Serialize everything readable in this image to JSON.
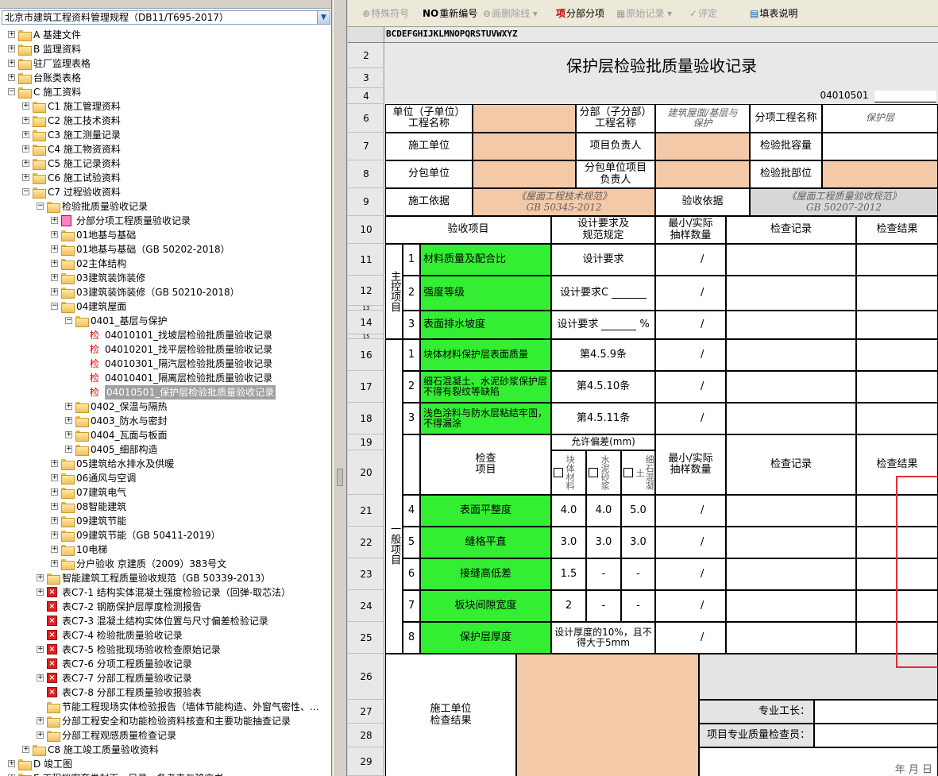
{
  "left_pane": {
    "spec_selector": "北京市建筑工程资料管理规程（DB11/T695-2017）",
    "tree": [
      {
        "label": "A 基建文件"
      },
      {
        "label": "B 监理资料"
      },
      {
        "label": "驻厂监理表格"
      },
      {
        "label": "台账类表格"
      },
      {
        "label": "C 施工资料"
      },
      {
        "label": "C1 施工管理资料"
      },
      {
        "label": "C2 施工技术资料"
      },
      {
        "label": "C3 施工测量记录"
      },
      {
        "label": "C4 施工物资资料"
      },
      {
        "label": "C5 施工记录资料"
      },
      {
        "label": "C6 施工试验资料"
      },
      {
        "label": "C7 过程验收资料"
      },
      {
        "label": "检验批质量验收记录"
      },
      {
        "label": "分部分项工程质量验收记录"
      },
      {
        "label": "01地基与基础"
      },
      {
        "label": "01地基与基础（GB 50202-2018）"
      },
      {
        "label": "02主体结构"
      },
      {
        "label": "03建筑装饰装修"
      },
      {
        "label": "03建筑装饰装修（GB 50210-2018）"
      },
      {
        "label": "04建筑屋面"
      },
      {
        "label": "0401_基层与保护"
      },
      {
        "label": "04010101_找坡层检验批质量验收记录"
      },
      {
        "label": "04010201_找平层检验批质量验收记录"
      },
      {
        "label": "04010301_隔汽层检验批质量验收记录"
      },
      {
        "label": "04010401_隔离层检验批质量验收记录"
      },
      {
        "label": "04010501_保护层检验批质量验收记录"
      },
      {
        "label": "0402_保温与隔热"
      },
      {
        "label": "0403_防水与密封"
      },
      {
        "label": "0404_瓦面与板面"
      },
      {
        "label": "0405_细部构造"
      },
      {
        "label": "05建筑给水排水及供暖"
      },
      {
        "label": "06通风与空调"
      },
      {
        "label": "07建筑电气"
      },
      {
        "label": "08智能建筑"
      },
      {
        "label": "09建筑节能"
      },
      {
        "label": "09建筑节能（GB 50411-2019）"
      },
      {
        "label": "10电梯"
      },
      {
        "label": "分户验收 京建质（2009）383号文"
      },
      {
        "label": "智能建筑工程质量验收规范（GB 50339-2013）"
      },
      {
        "label": "表C7-1 结构实体混凝土强度检验记录（回弹-取芯法）"
      },
      {
        "label": "表C7-2 钢筋保护层厚度检测报告"
      },
      {
        "label": "表C7-3 混凝土结构实体位置与尺寸偏差检验记录"
      },
      {
        "label": "表C7-4 检验批质量验收记录"
      },
      {
        "label": "表C7-5 检验批现场验收检查原始记录"
      },
      {
        "label": "表C7-6 分项工程质量验收记录"
      },
      {
        "label": "表C7-7 分部工程质量验收记录"
      },
      {
        "label": "表C7-8 分部工程质量验收报验表"
      },
      {
        "label": "节能工程现场实体检验报告（墙体节能构造、外窗气密性、..."
      },
      {
        "label": "分部工程安全和功能检验资料核查和主要功能抽查记录"
      },
      {
        "label": "分部工程观感质量检查记录"
      },
      {
        "label": "C8 施工竣工质量验收资料"
      },
      {
        "label": "D 竣工图"
      },
      {
        "label": "E 工程档案套卷封面、目录、备考表与移交书"
      }
    ],
    "check_glyph": "检"
  },
  "toolbar": {
    "special_symbol": "特殊符号",
    "renumber_icon": "NO",
    "renumber": "重新编号",
    "delete_line": "画删除线",
    "sub_item_icon": "项",
    "sub_item": "分部分项",
    "raw_record": "原始记录",
    "evaluate": "评定",
    "fill_guide": "填表说明"
  },
  "sheet": {
    "col_letters": "BCDEFGHIJKLMNOPQRSTUVWXYZ",
    "row_numbers": [
      "2",
      "3",
      "4",
      "6",
      "7",
      "8",
      "9",
      "10",
      "11",
      "12",
      "13",
      "14",
      "15",
      "16",
      "17",
      "18",
      "19",
      "20",
      "21",
      "22",
      "23",
      "24",
      "25",
      "26",
      "27",
      "28",
      "29"
    ],
    "title": "保护层检验批质量验收记录",
    "code": "04010501",
    "header": {
      "unit_label": "单位（子单位）\n工程名称",
      "sub_div_label": "分部（子分部）\n工程名称",
      "sub_div_value": "建筑屋面/基层与\n保护",
      "item_label": "分项工程名称",
      "item_value": "保护层",
      "contractor_label": "施工单位",
      "pm_label": "项目负责人",
      "batch_capacity_label": "检验批容量",
      "subcontractor_label": "分包单位",
      "sub_pm_label": "分包单位项目\n负责人",
      "batch_location_label": "检验批部位",
      "basis_label": "施工依据",
      "basis_value": "《屋面工程技术规范》\nGB 50345-2012",
      "acceptance_basis_label": "验收依据",
      "acceptance_basis_value": "《屋面工程质量验收规范》\nGB 50207-2012"
    },
    "columns": {
      "item": "验收项目",
      "design": "设计要求及\n规范规定",
      "sample": "最小/实际\n抽样数量",
      "record": "检查记录",
      "result": "检查结果"
    },
    "main_control_label": "主控项目",
    "main_items": [
      {
        "no": "1",
        "name": "材料质量及配合比",
        "req": "设计要求",
        "slash": "/"
      },
      {
        "no": "2",
        "name": "强度等级",
        "req": "设计要求C",
        "slash": "/"
      },
      {
        "no": "3",
        "name": "表面排水坡度",
        "req": "设计要求",
        "unit": "%",
        "slash": "/"
      }
    ],
    "general_label": "一般项目",
    "general_items": [
      {
        "no": "1",
        "name": "块体材料保护层表面质量",
        "req": "第4.5.9条",
        "slash": "/"
      },
      {
        "no": "2",
        "name": "细石混凝土、水泥砂浆保护层不得有裂纹等缺陷",
        "req": "第4.5.10条",
        "slash": "/"
      },
      {
        "no": "3",
        "name": "浅色涂料与防水层粘结牢固，不得漏涂",
        "req": "第4.5.11条",
        "slash": "/"
      }
    ],
    "tolerance_header": "允许偏差(mm)",
    "check_item_label": "检查\n项目",
    "materials": [
      "块体材料",
      "水泥砂浆",
      "细石混凝土"
    ],
    "tolerance_items": [
      {
        "no": "4",
        "name": "表面平整度",
        "v": [
          "4.0",
          "4.0",
          "5.0"
        ],
        "slash": "/"
      },
      {
        "no": "5",
        "name": "缝格平直",
        "v": [
          "3.0",
          "3.0",
          "3.0"
        ],
        "slash": "/"
      },
      {
        "no": "6",
        "name": "接缝高低差",
        "v": [
          "1.5",
          "-",
          "-"
        ],
        "slash": "/"
      },
      {
        "no": "7",
        "name": "板块间隙宽度",
        "v": [
          "2",
          "-",
          "-"
        ],
        "slash": "/"
      },
      {
        "no": "8",
        "name": "保护层厚度",
        "v": [
          "设计厚度的10%，且不得大于5mm"
        ],
        "slash": "/"
      }
    ],
    "footer": {
      "result_label": "施工单位\n检查结果",
      "foreman_label": "专业工长：",
      "qc_label": "项目专业质量检查员：",
      "date": "年   月   日"
    }
  }
}
